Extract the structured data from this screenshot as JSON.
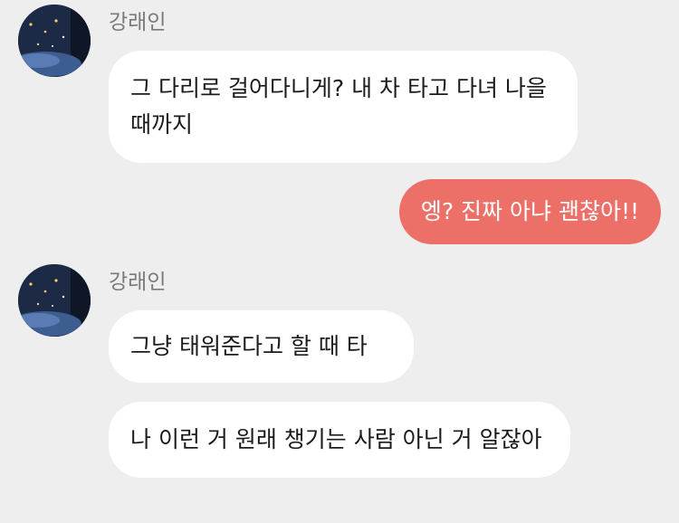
{
  "colors": {
    "background": "#eeeeee",
    "incoming_bubble": "#ffffff",
    "outgoing_bubble": "#ec6f68",
    "sender_name": "#7a7a7a"
  },
  "chat": {
    "groups": [
      {
        "sender": "강래인",
        "avatar_icon": "night-sky-avatar",
        "messages": [
          "그 다리로 걸어다니게? 내 차 타고 다녀 나을 때까지"
        ]
      },
      {
        "sender": "me",
        "messages": [
          "엥? 진짜 아냐 괜찮아!!"
        ]
      },
      {
        "sender": "강래인",
        "avatar_icon": "night-sky-avatar",
        "messages": [
          "그냥 태워준다고 할 때 타",
          "나 이런 거 원래 챙기는 사람 아닌 거 알잖아"
        ]
      }
    ]
  }
}
